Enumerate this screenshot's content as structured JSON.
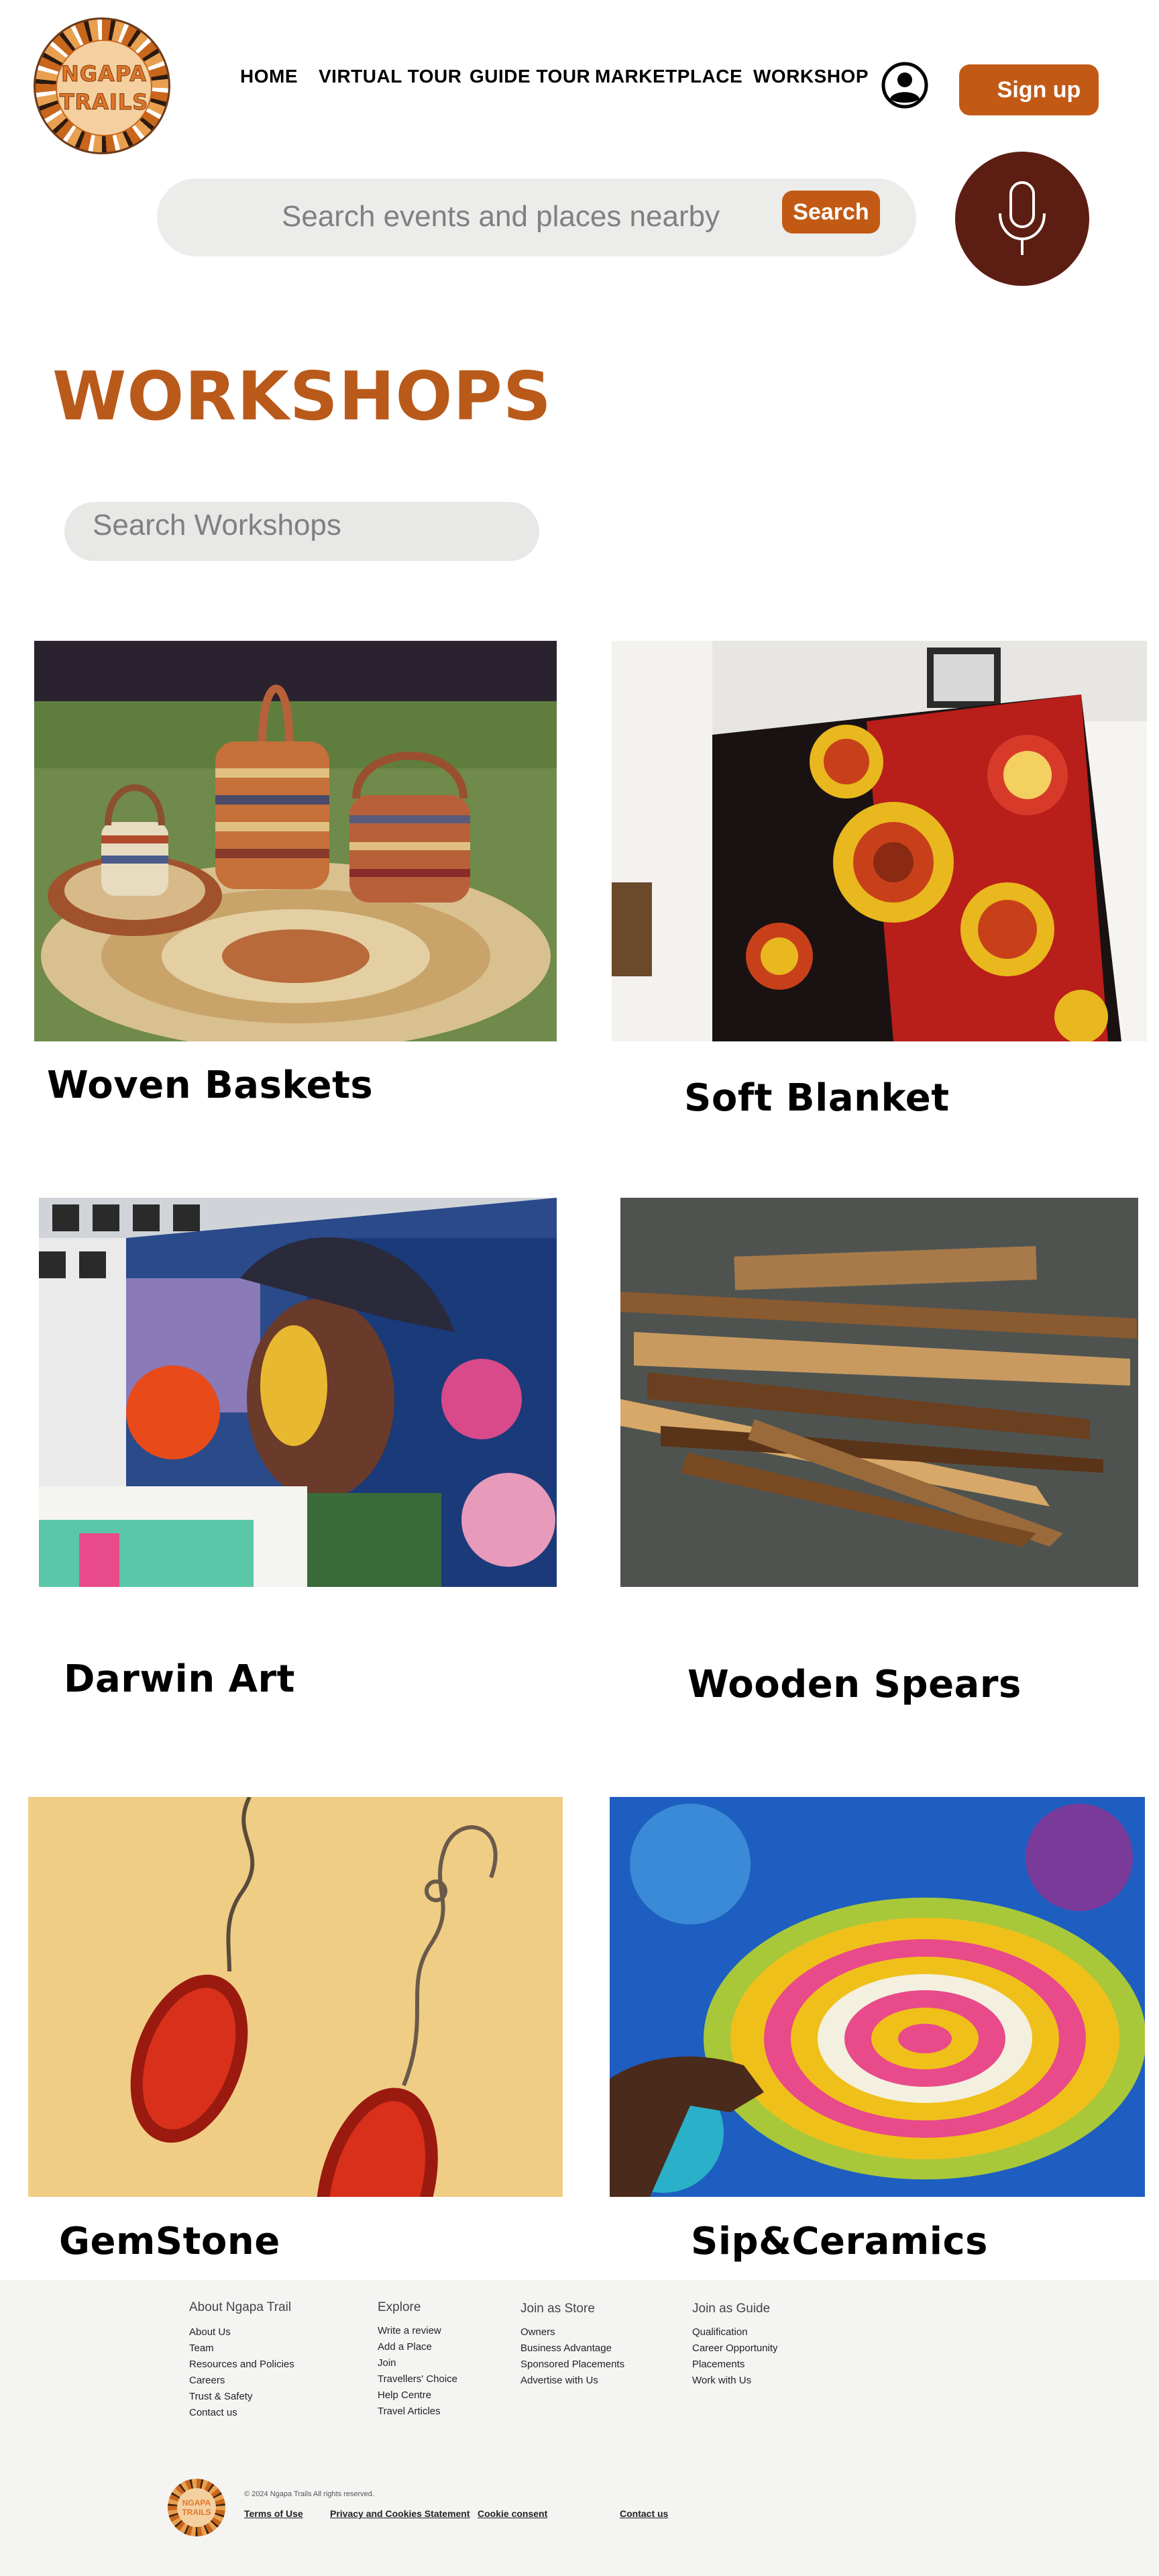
{
  "brand": {
    "logo_line1": "NGAPA",
    "logo_line2": "TRAILS"
  },
  "nav": {
    "items": [
      {
        "label": "HOME"
      },
      {
        "label": "VIRTUAL TOUR"
      },
      {
        "label": "GUIDE TOUR"
      },
      {
        "label": "MARKETPLACE"
      },
      {
        "label": "WORKSHOP"
      }
    ]
  },
  "header": {
    "signup_label": "Sign up",
    "user_icon": "user-circle-icon"
  },
  "search": {
    "placeholder": "Search events and places nearby",
    "button_label": "Search",
    "mic_icon": "microphone-icon"
  },
  "page": {
    "title": "WORKSHOPS"
  },
  "workshop_search": {
    "placeholder": "Search Workshops"
  },
  "workshops": [
    {
      "title": "Woven Baskets"
    },
    {
      "title": "Soft Blanket"
    },
    {
      "title": "Darwin Art"
    },
    {
      "title": "Wooden Spears"
    },
    {
      "title": "GemStone"
    },
    {
      "title": "Sip&Ceramics"
    }
  ],
  "footer": {
    "columns": [
      {
        "heading": "About Ngapa Trail",
        "links": [
          "About Us",
          "Team",
          "Resources and Policies",
          "Careers",
          "Trust & Safety",
          "Contact us"
        ]
      },
      {
        "heading": "Explore",
        "links": [
          "Write a review",
          "Add a Place",
          "Join",
          "Travellers' Choice",
          "Help Centre",
          "Travel Articles"
        ]
      },
      {
        "heading": "Join as Store",
        "links": [
          "Owners",
          "Business Advantage",
          "Sponsored Placements",
          "Advertise with Us"
        ]
      },
      {
        "heading": "Join as Guide",
        "links": [
          "Qualification",
          "Career Opportunity",
          "Placements",
          "Work with Us"
        ]
      }
    ],
    "copyright": "© 2024 Ngapa Trails All rights reserved.",
    "bottom_links": [
      "Terms of Use",
      "Privacy and Cookies Statement",
      "Cookie consent",
      "Contact us"
    ]
  },
  "colors": {
    "accent": "#c25a15",
    "title": "#b95a1a",
    "mic_bg": "#5c1e12",
    "footer_bg": "#f4f4f3"
  }
}
